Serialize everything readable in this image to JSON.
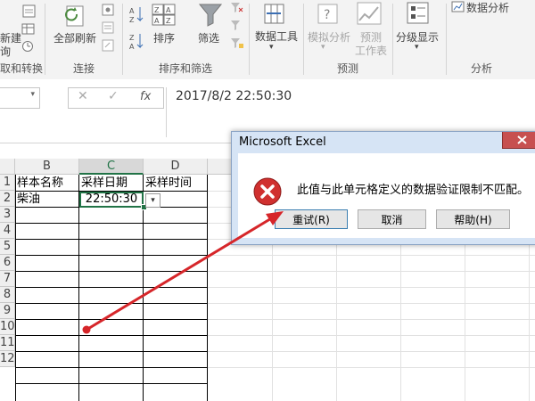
{
  "ribbon": {
    "left_fragments": [
      "新建",
      "询",
      "取和转换"
    ],
    "refresh_all": "全部刷新",
    "connections": "连接",
    "sort": "排序",
    "sort_and_filter": "排序和筛选",
    "filter": "筛选",
    "data_tools": "数据工具",
    "what_if": "模拟分析",
    "forecast_sheet_1": "预测",
    "forecast_sheet_2": "工作表",
    "forecast": "预测",
    "outline": "分级显示",
    "data_analysis": "数据分析",
    "analysis": "分析"
  },
  "formula_bar": {
    "fx": "fx",
    "value": "2017/8/2  22:50:30"
  },
  "sheet": {
    "columns": [
      "B",
      "C",
      "D"
    ],
    "rows": [
      "1",
      "2",
      "3",
      "4",
      "5",
      "6",
      "7",
      "8",
      "9",
      "10",
      "11",
      "12"
    ],
    "header_b": "样本名称",
    "header_c": "采样日期",
    "header_d": "采样时间",
    "b1": "柴油",
    "c1": "22:50:30"
  },
  "dialog": {
    "title": "Microsoft Excel",
    "message": "此值与此单元格定义的数据验证限制不匹配。",
    "retry": "重试(R)",
    "cancel": "取消",
    "help": "帮助(H)"
  },
  "colors": {
    "excel_green": "#217346",
    "error_red": "#d0302f",
    "annotation_red": "#d6262a"
  }
}
